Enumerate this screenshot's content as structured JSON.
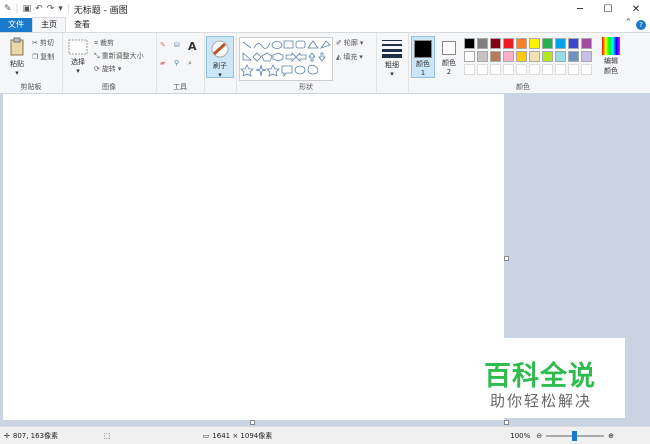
{
  "window": {
    "title": "无标题 - 画图",
    "controls": {
      "minimize": "─",
      "maximize": "☐",
      "close": "✕"
    }
  },
  "tabs": {
    "file": "文件",
    "home": "主页",
    "view": "查看"
  },
  "ribbon": {
    "clipboard": {
      "paste": "粘贴",
      "cut": "剪切",
      "copy": "复制",
      "label": "剪贴板"
    },
    "image": {
      "select": "选择",
      "crop": "裁剪",
      "resize": "重新调整大小",
      "rotate": "旋转",
      "label": "图像"
    },
    "tools": {
      "label": "工具",
      "text_glyph": "A"
    },
    "brushes": {
      "label": "刷子"
    },
    "shapes": {
      "outline": "轮廓",
      "fill": "填充",
      "label": "形状"
    },
    "size": {
      "label": "粗细"
    },
    "colors": {
      "color1": "颜色 1",
      "color2": "颜色 2",
      "edit": "编辑颜色",
      "label": "颜色",
      "palette_row1": [
        "#000000",
        "#7f7f7f",
        "#880015",
        "#ed1c24",
        "#ff7f27",
        "#fff200",
        "#22b14c",
        "#00a2e8",
        "#3f48cc",
        "#a349a4"
      ],
      "palette_row2": [
        "#ffffff",
        "#c3c3c3",
        "#b97a57",
        "#ffaec9",
        "#ffc90e",
        "#efe4b0",
        "#b5e61d",
        "#99d9ea",
        "#7092be",
        "#c8bfe7"
      ]
    }
  },
  "status": {
    "cursor": "807, 163像素",
    "image_size": "1641 × 1094像素",
    "zoom": "100%"
  },
  "watermark": {
    "title": "百科全说",
    "subtitle": "助你轻松解决"
  }
}
